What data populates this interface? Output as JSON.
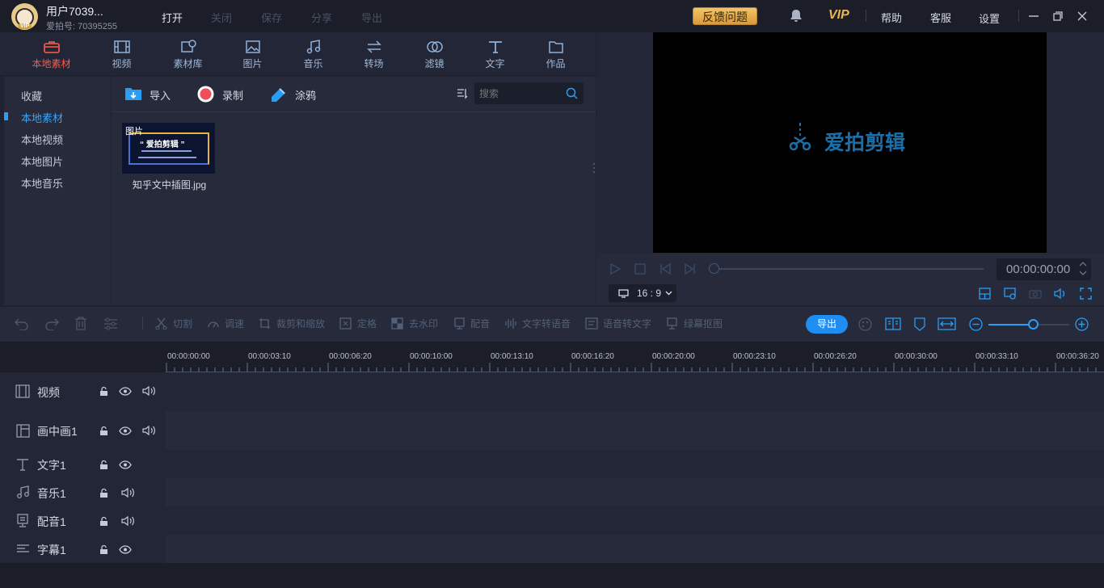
{
  "titlebar": {
    "username": "用户7039...",
    "userid": "爱拍号: 70395255",
    "menu": [
      "打开",
      "关闭",
      "保存",
      "分享",
      "导出"
    ],
    "feedback": "反馈问题",
    "vip": "VIP",
    "help": "帮助",
    "service": "客服",
    "settings": "设置",
    "avatar_badge": "VIP"
  },
  "categories": [
    "本地素材",
    "视频",
    "素材库",
    "图片",
    "音乐",
    "转场",
    "滤镜",
    "文字",
    "作品"
  ],
  "sidebar": [
    "收藏",
    "本地素材",
    "本地视频",
    "本地图片",
    "本地音乐"
  ],
  "media_toolbar": {
    "import": "导入",
    "record": "录制",
    "doodle": "涂鸦",
    "search_placeholder": "搜索"
  },
  "media_items": [
    {
      "name": "知乎文中插图.jpg",
      "tag": "图片",
      "thumb_title": "“ 爱拍剪辑 ”"
    }
  ],
  "preview": {
    "watermark": "爱拍剪辑",
    "timecode": "00:00:00:00",
    "ratio": "16 : 9"
  },
  "timeline_tools": [
    "切割",
    "调速",
    "裁剪和缩放",
    "定格",
    "去水印",
    "配音",
    "文字转语音",
    "语音转文字",
    "绿幕抠图"
  ],
  "export_label": "导出",
  "ruler": [
    "00:00:00:00",
    "00:00:03:10",
    "00:00:06:20",
    "00:00:10:00",
    "00:00:13:10",
    "00:00:16:20",
    "00:00:20:00",
    "00:00:23:10",
    "00:00:26:20",
    "00:00:30:00",
    "00:00:33:10",
    "00:00:36:20"
  ],
  "tracks": [
    "视频",
    "画中画1",
    "文字1",
    "音乐1",
    "配音1",
    "字幕1"
  ],
  "colors": {
    "accent": "#1e8ef3",
    "active_tab": "#ff5b4b",
    "vip": "#e7b556"
  }
}
